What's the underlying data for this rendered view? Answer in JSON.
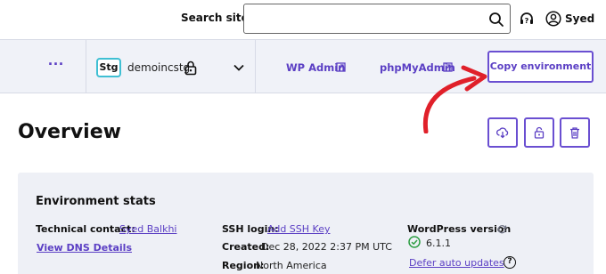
{
  "header": {
    "search_label": "Search sites",
    "search_value": "",
    "user_name": "Syed"
  },
  "env_bar": {
    "more_label": "...",
    "env_badge": "Stg",
    "env_name": "demoincstg",
    "wp_admin_label": "WP Admin",
    "phpmyadmin_label": "phpMyAdmin",
    "copy_env_label": "Copy environment"
  },
  "overview": {
    "title": "Overview"
  },
  "stats": {
    "title": "Environment stats",
    "technical_contact_label": "Technical contact:",
    "technical_contact_value": "Syed Balkhi",
    "dns_link": "View DNS Details",
    "ssh_login_label": "SSH login:",
    "ssh_login_value": "Add SSH Key",
    "created_label": "Created:",
    "created_value": "Dec 28, 2022 2:37 PM UTC",
    "region_label": "Region:",
    "region_value": "North America",
    "wp_version_label": "WordPress version",
    "wp_version_value": "6.1.1",
    "defer_link": "Defer auto updates",
    "help_glyph": "?"
  },
  "colors": {
    "accent": "#5b3fc4",
    "badge_border": "#3fbfd3",
    "arrow": "#e0202a",
    "success": "#2e9e44"
  }
}
